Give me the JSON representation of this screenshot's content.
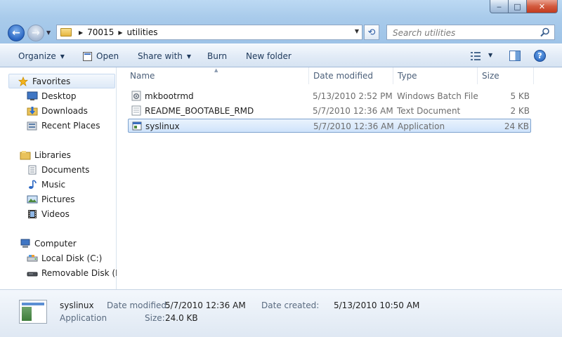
{
  "window": {
    "caption": {
      "minimize": "‒",
      "maximize": "□",
      "close": "✕"
    }
  },
  "address": {
    "crumbs": [
      "70015",
      "utilities"
    ],
    "search_placeholder": "Search utilities"
  },
  "toolbar": {
    "organize": "Organize",
    "open": "Open",
    "share_with": "Share with",
    "burn": "Burn",
    "new_folder": "New folder",
    "help": "?"
  },
  "nav": {
    "favorites": {
      "label": "Favorites",
      "items": [
        "Desktop",
        "Downloads",
        "Recent Places"
      ]
    },
    "libraries": {
      "label": "Libraries",
      "items": [
        "Documents",
        "Music",
        "Pictures",
        "Videos"
      ]
    },
    "computer": {
      "label": "Computer",
      "items": [
        "Local Disk (C:)",
        "Removable Disk (E:)"
      ]
    }
  },
  "columns": [
    "Name",
    "Date modified",
    "Type",
    "Size"
  ],
  "files": [
    {
      "name": "mkbootrmd",
      "date": "5/13/2010 2:52 PM",
      "type": "Windows Batch File",
      "size": "5 KB",
      "icon": "batch-file-icon"
    },
    {
      "name": "README_BOOTABLE_RMD",
      "date": "5/7/2010 12:36 AM",
      "type": "Text Document",
      "size": "2 KB",
      "icon": "text-file-icon"
    },
    {
      "name": "syslinux",
      "date": "5/7/2010 12:36 AM",
      "type": "Application",
      "size": "24 KB",
      "icon": "application-icon",
      "selected": true
    }
  ],
  "details": {
    "name": "syslinux",
    "kind": "Application",
    "date_modified_label": "Date modified:",
    "date_modified": "5/7/2010 12:36 AM",
    "date_created_label": "Date created:",
    "date_created": "5/13/2010 10:50 AM",
    "size_label": "Size:",
    "size": "24.0 KB"
  },
  "colors": {
    "accent": "#2a66c2",
    "selection": "#cfe3fb",
    "chrome": "#a9cbeb"
  }
}
